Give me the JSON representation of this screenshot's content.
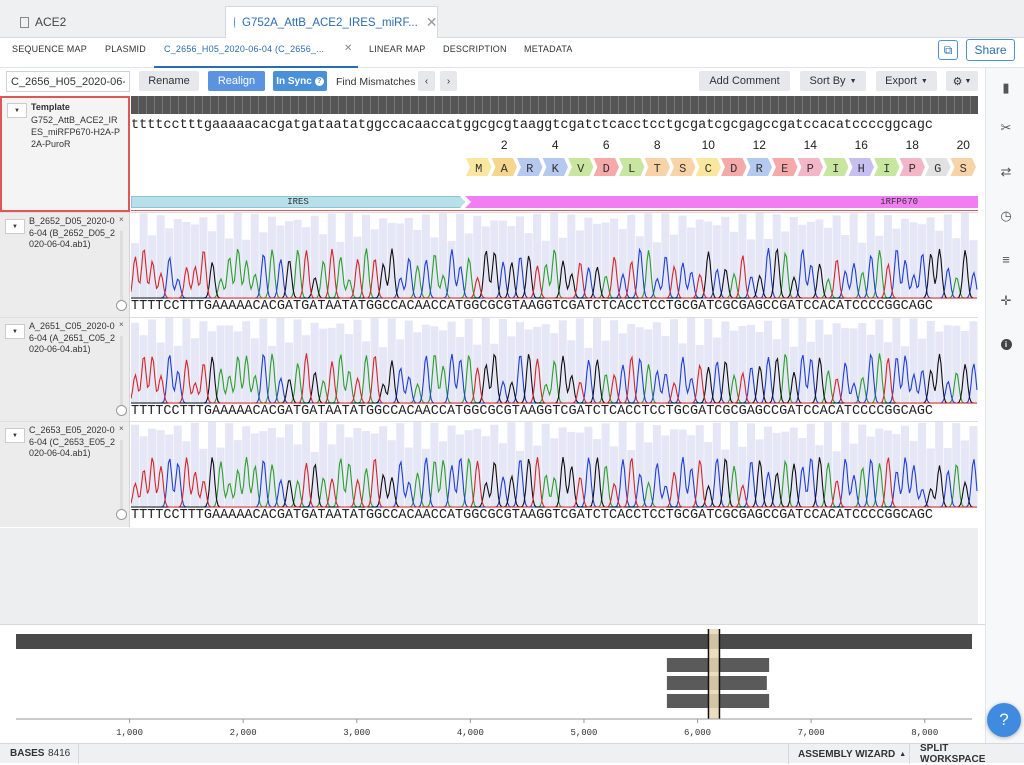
{
  "top_tabs": [
    {
      "label": "ACE2"
    },
    {
      "label": "G752A_AttB_ACE2_IRES_miRF..."
    }
  ],
  "sub_tabs": [
    {
      "label": "SEQUENCE MAP"
    },
    {
      "label": "PLASMID"
    },
    {
      "label": "C_2656_H05_2020-06-04 (C_2656_..."
    },
    {
      "label": "LINEAR MAP"
    },
    {
      "label": "DESCRIPTION"
    },
    {
      "label": "METADATA"
    }
  ],
  "share_label": "Share",
  "toolbar": {
    "name_value": "C_2656_H05_2020-06-",
    "rename": "Rename",
    "realign": "Realign",
    "in_sync": "In Sync",
    "find_mismatches": "Find Mismatches",
    "add_comment": "Add Comment",
    "sort_by": "Sort By",
    "export": "Export"
  },
  "template": {
    "title": "Template",
    "name": "G752_AttB_ACE2_IRES_miRFP670-H2A-P2A-PuroR",
    "sequence": "ttttcctttgaaaaacacgatgataatatggccacaaccatggcgcgtaaggtcgatctcacctcctgcgatcgcgagccgatccacatccccggcagc",
    "amino_acids": [
      "M",
      "A",
      "R",
      "K",
      "V",
      "D",
      "L",
      "T",
      "S",
      "C",
      "D",
      "R",
      "E",
      "P",
      "I",
      "H",
      "I",
      "P",
      "G",
      "S"
    ],
    "aa_numbers": [
      "2",
      "4",
      "6",
      "8",
      "10",
      "12",
      "14",
      "16",
      "18",
      "20"
    ],
    "features": [
      {
        "label": "IRES",
        "color": "#b7e0ea"
      },
      {
        "label": "iRFP670",
        "color": "#f07ef2"
      }
    ]
  },
  "reads": [
    {
      "name": "B_2652_D05_2020-06-04 (B_2652_D05_2020-06-04.ab1)",
      "sequence": "TTTTCCTTTGAAAAACACGATGATAATATGGCCACAACCATGGCGCGTAAGGTCGATCTCACCTCCTGCGATCGCGAGCCGATCCACATCCCCGGCAGC"
    },
    {
      "name": "A_2651_C05_2020-06-04 (A_2651_C05_2020-06-04.ab1)",
      "sequence": "TTTTCCTTTGAAAAACACGATGATAATATGGCCACAACCATGGCGCGTAAGGTCGATCTCACCTCCTGCGATCGCGAGCCGATCCACATCCCCGGCAGC"
    },
    {
      "name": "C_2653_E05_2020-06-04 (C_2653_E05_2020-06-04.ab1)",
      "sequence": "TTTTCCTTTGAAAAACACGATGATAATATGGCCACAACCATGGCGCGTAAGGTCGATCTCACCTCCTGCGATCGCGAGCCGATCCACATCCCCGGCAGC"
    }
  ],
  "overview": {
    "total_bases": 8416,
    "axis_ticks": [
      "1,000",
      "2,000",
      "3,000",
      "4,000",
      "5,000",
      "6,000",
      "7,000",
      "8,000"
    ],
    "read_bars": [
      {
        "start": 5730,
        "end": 6630
      },
      {
        "start": 5730,
        "end": 6610
      },
      {
        "start": 5730,
        "end": 6630
      }
    ],
    "cursor": 6140
  },
  "status": {
    "bases_label": "BASES",
    "bases_value": "8416",
    "assembly_wizard": "ASSEMBLY WIZARD",
    "split_workspace": "SPLIT WORKSPACE"
  },
  "colors": {
    "accent": "#4a90d9",
    "trace_A": "#2ca02c",
    "trace_C": "#1f3fd6",
    "trace_G": "#111111",
    "trace_T": "#d62728"
  },
  "help_label": "?"
}
